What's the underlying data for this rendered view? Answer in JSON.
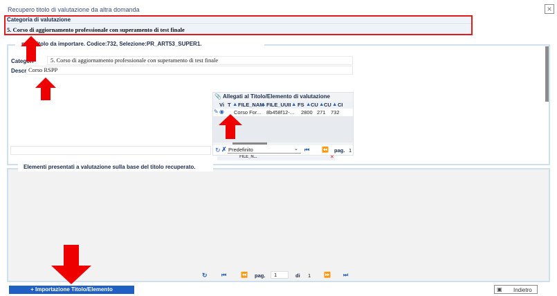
{
  "window": {
    "title": "Recupero titolo di valutazione da altra domanda",
    "close_glyph": "×"
  },
  "category": {
    "header": "Categoria di valutazione",
    "value": "5. Corso di aggiornamento professionale con superamento di test finale"
  },
  "fieldset1": {
    "legend": "nuto titolo da importare. Codice:732, Selezione:PR_ART53_SUPER1.",
    "category_label": "Categori",
    "category_value": "5. Corso di aggiornamento professionale con superamento di test finale",
    "descr_label": "Descr.",
    "descr_value": "Corso RSPP"
  },
  "attachments": {
    "title": "Allegati al Titolo/Elemento di valutazione",
    "columns": [
      "Vi",
      "T",
      "FILE_NAM",
      "FILE_UUII",
      "FS",
      "CU",
      "CU",
      "CI"
    ],
    "row": [
      "Corso For...",
      "8b458f12-...",
      "2800",
      "271",
      "732"
    ],
    "pager": {
      "preset": "Predefinito",
      "page_label": "pag.",
      "page": "1"
    },
    "filter_label": "FILE_N..."
  },
  "fieldset2": {
    "legend": "Elementi presentati a valutazione sulla base del titolo recuperato.",
    "pager": {
      "page_label": "pag.",
      "page": "1",
      "of_label": "di",
      "total": "1"
    }
  },
  "buttons": {
    "import": "+ Importazione Titolo/Elemento",
    "back": "Indietro"
  },
  "colors": {
    "highlight": "#e21a1a",
    "arrow": "#ee0000",
    "primary_button": "#2060c4",
    "panel_border": "#cfe0ec"
  },
  "icons": [
    "close-icon",
    "paperclip-icon",
    "refresh-icon",
    "clear-filter-icon",
    "first-page-icon",
    "prev-page-icon",
    "next-page-icon",
    "last-page-icon",
    "back-icon",
    "sort-icon",
    "edit-icon",
    "view-icon"
  ]
}
